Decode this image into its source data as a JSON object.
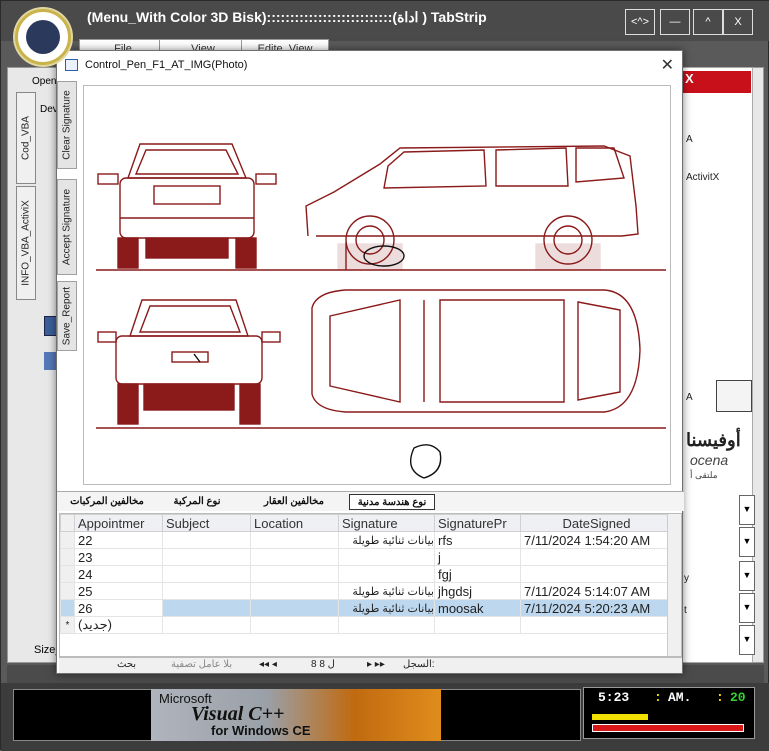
{
  "app": {
    "title": "(Menu_With Color 3D Bisk):::::::::::::::::::::::::::(اداة ) TabStrip",
    "window_buttons": [
      "<^>",
      "—",
      "^",
      "X"
    ]
  },
  "menu_tabs": [
    "File",
    "View",
    "Edite_View"
  ],
  "background": {
    "open_label": "Open",
    "dev_label": "Dev",
    "left_tabs": [
      "Cod_VBA",
      "INFO_VBA_ActiviX"
    ],
    "size_label": "Size_",
    "right_panel": {
      "red_label": "X",
      "a_label": "A",
      "activex_label": "ActivitX",
      "a2_label": "A",
      "brand_text": "أوفيسنا",
      "brand_sub": "ocena",
      "brand_ar": "ملتقى أ",
      "field_labels": [
        "",
        "",
        "y",
        "t",
        ""
      ]
    }
  },
  "dialog": {
    "title": "Control_Pen_F1_AT_IMG(Photo)",
    "side_buttons": [
      "Clear Signature",
      "Accept Signature",
      "Save_Report"
    ],
    "inner_tabs": [
      "نوع هندسة مدنية",
      "مخالفين العقار",
      "نوع المركبة",
      "مخالفين المركبات"
    ],
    "columns": [
      "Appointmer",
      "Subject",
      "Location",
      "Signature",
      "SignaturePr",
      "DateSigned"
    ],
    "rows": [
      {
        "id": "22",
        "subject": "",
        "location": "",
        "signature": "بيانات ثنائية طويلة",
        "sigpr": "rfs",
        "date": "7/11/2024 1:54:20 AM"
      },
      {
        "id": "23",
        "subject": "",
        "location": "",
        "signature": "",
        "sigpr": "j",
        "date": ""
      },
      {
        "id": "24",
        "subject": "",
        "location": "",
        "signature": "",
        "sigpr": "fgj",
        "date": ""
      },
      {
        "id": "25",
        "subject": "",
        "location": "",
        "signature": "بيانات ثنائية طويلة",
        "sigpr": "jhgdsj",
        "date": "7/11/2024 5:14:07 AM"
      },
      {
        "id": "26",
        "subject": "",
        "location": "",
        "signature": "بيانات ثنائية طويلة",
        "sigpr": "moosak",
        "date": "7/11/2024 5:20:23 AM"
      }
    ],
    "new_row": "(جديد)",
    "nav": {
      "record_label": "السجل:",
      "record_value": "8 ل 8",
      "no_filter": "بلا عامل تصفية",
      "search": "بحث"
    }
  },
  "banner": {
    "ms": "Microsoft",
    "big": "Visual C++",
    "ce": "for Windows CE"
  },
  "clock": {
    "hour": "5:23",
    "ampm": "AM.",
    "sec": "20"
  },
  "colors": {
    "accent_red": "#c8101a",
    "drawing": "#8b1a1a",
    "selection": "#bcd7ee"
  }
}
